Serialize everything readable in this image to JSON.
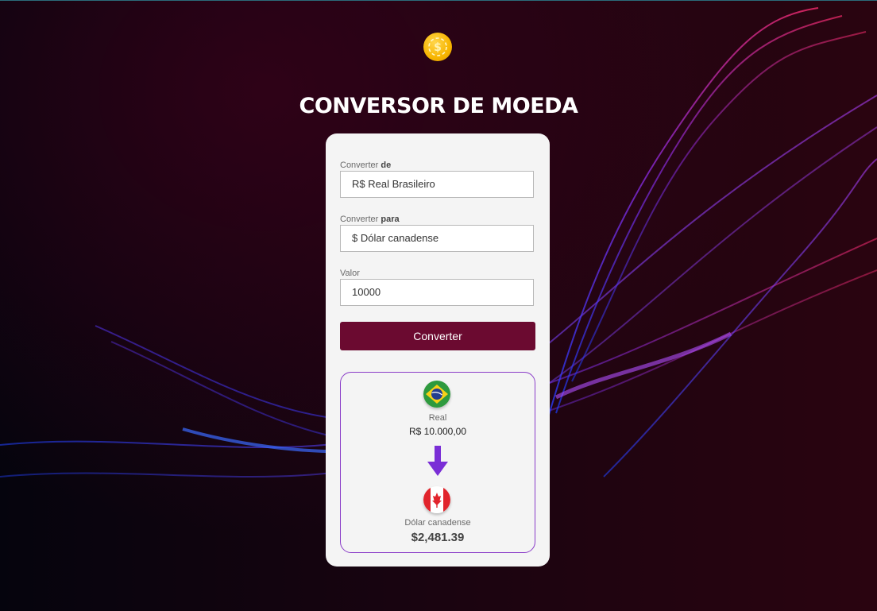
{
  "header": {
    "title": "CONVERSOR DE MOEDA",
    "logo_icon": "dollar-coin-icon"
  },
  "form": {
    "from_label_prefix": "Converter ",
    "from_label_bold": "de",
    "from_value": "R$ Real Brasileiro",
    "to_label_prefix": "Converter ",
    "to_label_bold": "para",
    "to_value": "$ Dólar canadense",
    "amount_label": "Valor",
    "amount_value": "10000",
    "convert_button": "Converter"
  },
  "result": {
    "from_flag_icon": "brazil-flag-icon",
    "from_currency_name": "Real",
    "from_currency_value": "R$ 10.000,00",
    "arrow_icon": "arrow-down-icon",
    "to_flag_icon": "canada-flag-icon",
    "to_currency_name": "Dólar canadense",
    "to_currency_value": "$2,481.39"
  },
  "colors": {
    "button": "#6b0a30",
    "result_border": "#8a3cc8",
    "arrow": "#7a2ed6",
    "coin": "#f7b500"
  }
}
